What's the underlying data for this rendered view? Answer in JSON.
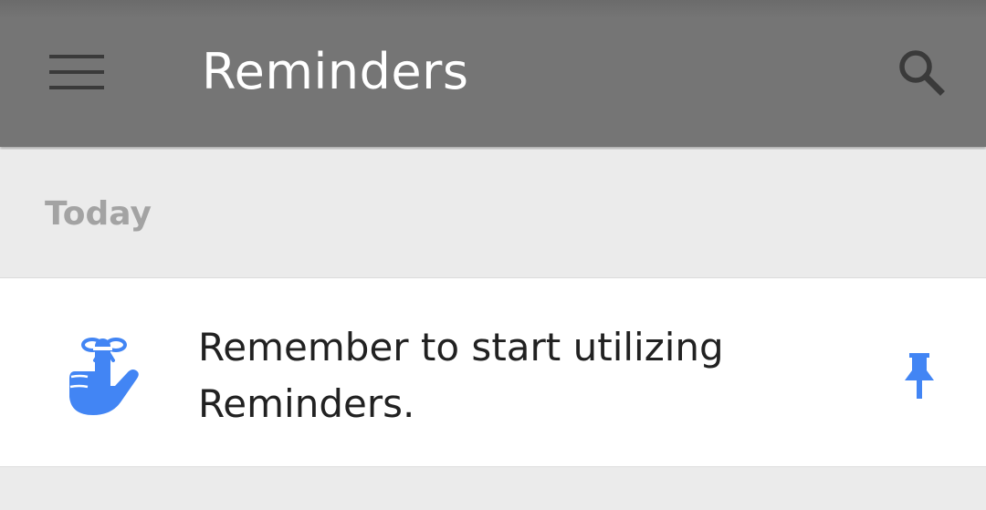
{
  "app_bar": {
    "title": "Reminders",
    "menu_icon": "hamburger-menu-icon",
    "search_icon": "search-icon",
    "background_color": "#757575"
  },
  "section": {
    "label": "Today"
  },
  "reminders": [
    {
      "text": "Remember to start utilizing Reminders.",
      "icon": "finger-string-reminder-icon",
      "pin_icon": "pin-icon",
      "accent_color": "#4285f4"
    }
  ]
}
